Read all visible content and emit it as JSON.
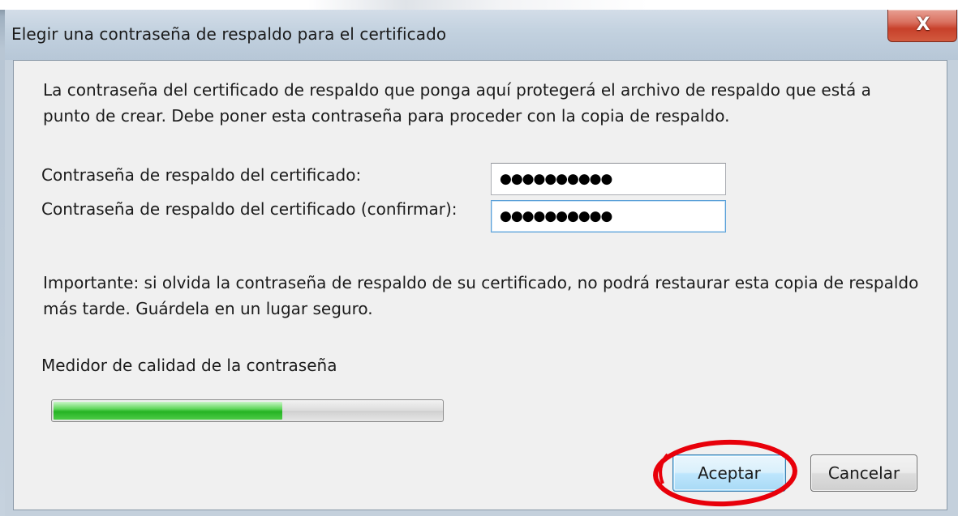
{
  "window": {
    "title": "Elegir una contraseña de respaldo para el certificado",
    "close_glyph": "X"
  },
  "dialog": {
    "description": "La contraseña del certificado de respaldo que ponga aquí protegerá el archivo de respaldo que está a punto de crear. Debe poner esta contraseña para proceder con la copia de respaldo.",
    "password_label": "Contraseña de respaldo del certificado:",
    "password_value": "●●●●●●●●●●",
    "confirm_label": "Contraseña de respaldo del certificado (confirmar):",
    "confirm_value": "●●●●●●●●●●",
    "warning": "Importante: si olvida la contraseña de respaldo de su certificado, no podrá restaurar esta copia de respaldo más tarde. Guárdela en un lugar seguro.",
    "meter_label": "Medidor de calidad de la contraseña",
    "meter_level_percent": 59,
    "ok_label": "Aceptar",
    "cancel_label": "Cancelar"
  },
  "colors": {
    "meter_fill": "#25b323",
    "annotation": "#e8000a",
    "close_button": "#c7402a"
  },
  "icons": {
    "close": "close-icon"
  }
}
